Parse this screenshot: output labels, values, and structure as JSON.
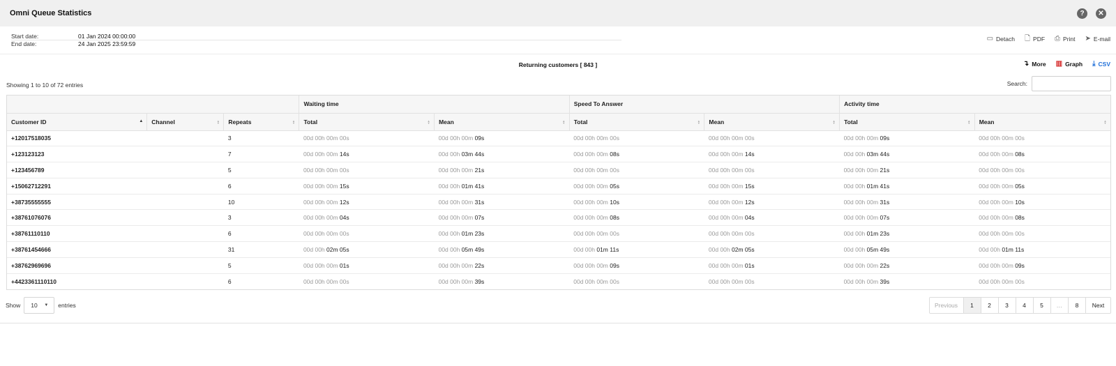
{
  "window": {
    "title": "Omni Queue Statistics"
  },
  "meta": {
    "start_label": "Start date:",
    "start_value": "01 Jan 2024 00:00:00",
    "end_label": "End date:",
    "end_value": "24 Jan 2025 23:59:59"
  },
  "export": {
    "detach": "Detach",
    "pdf": "PDF",
    "print": "Print",
    "email": "E-mail"
  },
  "report": {
    "title": "Returning customers [ 843 ]",
    "more": "More",
    "graph": "Graph",
    "csv": "CSV",
    "csv_color": "#1e6fd9",
    "graph_color": "#d62b2b"
  },
  "controls": {
    "showing": "Showing 1 to 10 of 72 entries",
    "search_label": "Search:",
    "search_value": ""
  },
  "table": {
    "groups": [
      "Waiting time",
      "Speed To Answer",
      "Activity time"
    ],
    "columns": [
      "Customer ID",
      "Channel",
      "Repeats",
      "Total",
      "Mean",
      "Total",
      "Mean",
      "Total",
      "Mean"
    ],
    "rows": [
      [
        "+12017518035",
        "",
        "3",
        [
          "00d 00h 00m 00s",
          ""
        ],
        [
          "00d 00h 00m ",
          "09s"
        ],
        [
          "00d 00h 00m 00s",
          ""
        ],
        [
          "00d 00h 00m 00s",
          ""
        ],
        [
          "00d 00h 00m ",
          "09s"
        ],
        [
          "00d 00h 00m 00s",
          ""
        ]
      ],
      [
        "+123123123",
        "",
        "7",
        [
          "00d 00h 00m ",
          "14s"
        ],
        [
          "00d 00h ",
          "03m 44s"
        ],
        [
          "00d 00h 00m ",
          "08s"
        ],
        [
          "00d 00h 00m ",
          "14s"
        ],
        [
          "00d 00h ",
          "03m 44s"
        ],
        [
          "00d 00h 00m ",
          "08s"
        ]
      ],
      [
        "+123456789",
        "",
        "5",
        [
          "00d 00h 00m 00s",
          ""
        ],
        [
          "00d 00h 00m ",
          "21s"
        ],
        [
          "00d 00h 00m 00s",
          ""
        ],
        [
          "00d 00h 00m 00s",
          ""
        ],
        [
          "00d 00h 00m ",
          "21s"
        ],
        [
          "00d 00h 00m 00s",
          ""
        ]
      ],
      [
        "+15062712291",
        "",
        "6",
        [
          "00d 00h 00m ",
          "15s"
        ],
        [
          "00d 00h ",
          "01m 41s"
        ],
        [
          "00d 00h 00m ",
          "05s"
        ],
        [
          "00d 00h 00m ",
          "15s"
        ],
        [
          "00d 00h ",
          "01m 41s"
        ],
        [
          "00d 00h 00m ",
          "05s"
        ]
      ],
      [
        "+38735555555",
        "",
        "10",
        [
          "00d 00h 00m ",
          "12s"
        ],
        [
          "00d 00h 00m ",
          "31s"
        ],
        [
          "00d 00h 00m ",
          "10s"
        ],
        [
          "00d 00h 00m ",
          "12s"
        ],
        [
          "00d 00h 00m ",
          "31s"
        ],
        [
          "00d 00h 00m ",
          "10s"
        ]
      ],
      [
        "+38761076076",
        "",
        "3",
        [
          "00d 00h 00m ",
          "04s"
        ],
        [
          "00d 00h 00m ",
          "07s"
        ],
        [
          "00d 00h 00m ",
          "08s"
        ],
        [
          "00d 00h 00m ",
          "04s"
        ],
        [
          "00d 00h 00m ",
          "07s"
        ],
        [
          "00d 00h 00m ",
          "08s"
        ]
      ],
      [
        "+38761110110",
        "",
        "6",
        [
          "00d 00h 00m 00s",
          ""
        ],
        [
          "00d 00h ",
          "01m 23s"
        ],
        [
          "00d 00h 00m 00s",
          ""
        ],
        [
          "00d 00h 00m 00s",
          ""
        ],
        [
          "00d 00h ",
          "01m 23s"
        ],
        [
          "00d 00h 00m 00s",
          ""
        ]
      ],
      [
        "+38761454666",
        "",
        "31",
        [
          "00d 00h ",
          "02m 05s"
        ],
        [
          "00d 00h ",
          "05m 49s"
        ],
        [
          "00d 00h ",
          "01m 11s"
        ],
        [
          "00d 00h ",
          "02m 05s"
        ],
        [
          "00d 00h ",
          "05m 49s"
        ],
        [
          "00d 00h ",
          "01m 11s"
        ]
      ],
      [
        "+38762969696",
        "",
        "5",
        [
          "00d 00h 00m ",
          "01s"
        ],
        [
          "00d 00h 00m ",
          "22s"
        ],
        [
          "00d 00h 00m ",
          "09s"
        ],
        [
          "00d 00h 00m ",
          "01s"
        ],
        [
          "00d 00h 00m ",
          "22s"
        ],
        [
          "00d 00h 00m ",
          "09s"
        ]
      ],
      [
        "+4423361110110",
        "",
        "6",
        [
          "00d 00h 00m 00s",
          ""
        ],
        [
          "00d 00h 00m ",
          "39s"
        ],
        [
          "00d 00h 00m 00s",
          ""
        ],
        [
          "00d 00h 00m 00s",
          ""
        ],
        [
          "00d 00h 00m ",
          "39s"
        ],
        [
          "00d 00h 00m 00s",
          ""
        ]
      ]
    ]
  },
  "footer": {
    "show_label": "Show",
    "length_value": "10",
    "entries_label": "entries",
    "previous": "Previous",
    "pages": [
      "1",
      "2",
      "3",
      "4",
      "5",
      "…",
      "8"
    ],
    "next": "Next",
    "active_page": "1"
  },
  "icons": {
    "help": "help-icon",
    "close": "close-icon",
    "detach": "window-icon",
    "pdf": "file-icon",
    "print": "printer-icon",
    "email": "paper-plane-icon",
    "more": "arrow-down-icon",
    "graph": "bar-chart-icon",
    "csv": "download-icon"
  }
}
